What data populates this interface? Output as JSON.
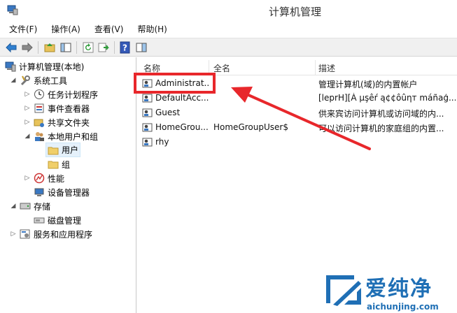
{
  "window": {
    "title": "计算机管理"
  },
  "menu": [
    "文件(F)",
    "操作(A)",
    "查看(V)",
    "帮助(H)"
  ],
  "tree": [
    {
      "label": "计算机管理(本地)",
      "icon": "computer-icon"
    },
    {
      "label": "系统工具",
      "icon": "tools-icon"
    },
    {
      "label": "任务计划程序",
      "icon": "clock-icon"
    },
    {
      "label": "事件查看器",
      "icon": "event-viewer-icon"
    },
    {
      "label": "共享文件夹",
      "icon": "shared-folder-icon"
    },
    {
      "label": "本地用户和组",
      "icon": "users-icon"
    },
    {
      "label": "用户",
      "icon": "folder-icon"
    },
    {
      "label": "组",
      "icon": "folder-icon"
    },
    {
      "label": "性能",
      "icon": "performance-icon"
    },
    {
      "label": "设备管理器",
      "icon": "device-manager-icon"
    },
    {
      "label": "存储",
      "icon": "storage-icon"
    },
    {
      "label": "磁盘管理",
      "icon": "disk-icon"
    },
    {
      "label": "服务和应用程序",
      "icon": "services-icon"
    }
  ],
  "list": {
    "columns": [
      "名称",
      "全名",
      "描述"
    ],
    "rows": [
      {
        "name": "Administrat...",
        "fullname": "",
        "desc": "管理计算机(域)的内置帐户"
      },
      {
        "name": "DefaultAcc...",
        "fullname": "",
        "desc": "[leprH][À µşêŕ ą¢¢ôûηт máñaģ..."
      },
      {
        "name": "Guest",
        "fullname": "",
        "desc": "供来宾访问计算机或访问域的内..."
      },
      {
        "name": "HomeGrou...",
        "fullname": "HomeGroupUser$",
        "desc": "可以访问计算机的家庭组的内置..."
      },
      {
        "name": "rhy",
        "fullname": "",
        "desc": ""
      }
    ]
  },
  "watermark": {
    "brand": "爱纯净",
    "url": "aichunjing.com"
  },
  "colors": {
    "highlight": "#e8272b",
    "accent": "#1f6fb5"
  }
}
